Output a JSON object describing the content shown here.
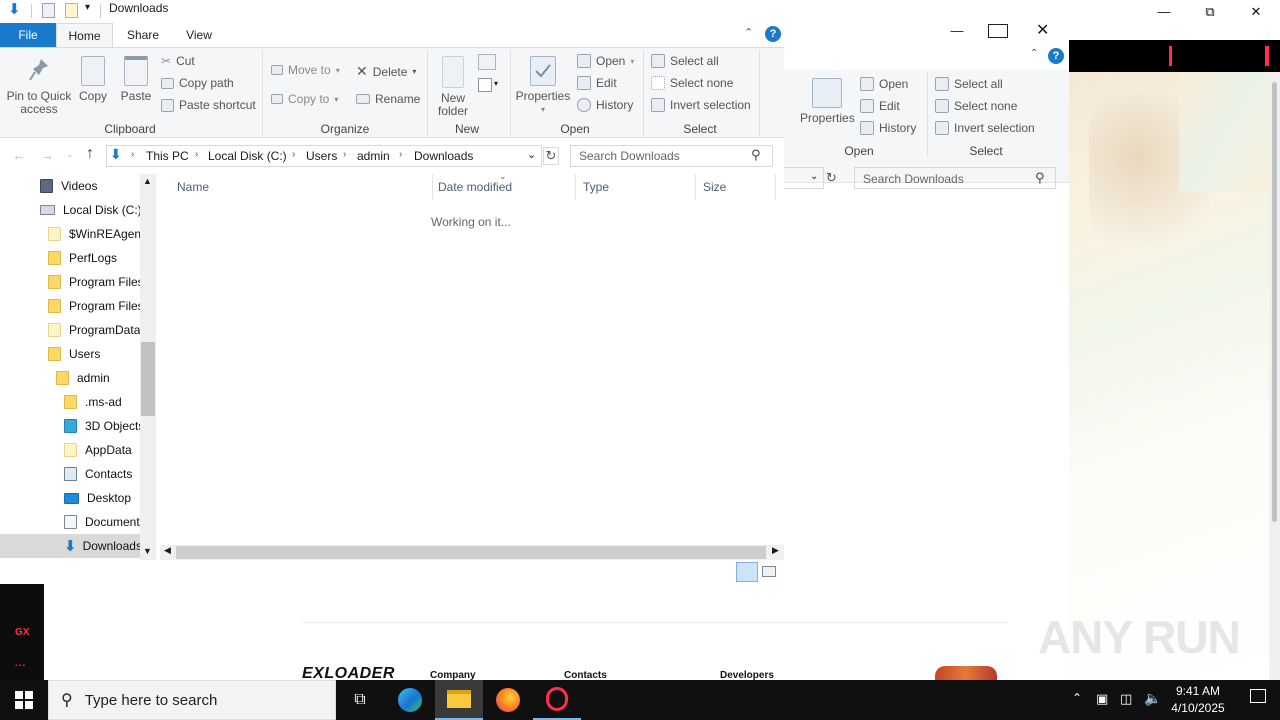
{
  "explorer": {
    "title": "Downloads",
    "tabs": {
      "file": "File",
      "home": "Home",
      "share": "Share",
      "view": "View"
    },
    "ribbon": {
      "pin_label": "Pin to Quick access",
      "copy_label": "Copy",
      "paste_label": "Paste",
      "cut_label": "Cut",
      "copy_path_label": "Copy path",
      "paste_shortcut_label": "Paste shortcut",
      "clipboard_group": "Clipboard",
      "move_to_label": "Move to",
      "copy_to_label": "Copy to",
      "delete_label": "Delete",
      "rename_label": "Rename",
      "organize_group": "Organize",
      "new_folder_label": "New folder",
      "new_group": "New",
      "properties_label": "Properties",
      "open_label": "Open",
      "edit_label": "Edit",
      "history_label": "History",
      "open_group": "Open",
      "select_all_label": "Select all",
      "select_none_label": "Select none",
      "invert_selection_label": "Invert selection",
      "select_group": "Select"
    },
    "address": {
      "crumbs": [
        "This PC",
        "Local Disk (C:)",
        "Users",
        "admin",
        "Downloads"
      ],
      "search_placeholder": "Search Downloads"
    },
    "nav": {
      "items": [
        {
          "label": "Videos"
        },
        {
          "label": "Local Disk (C:)"
        },
        {
          "label": "$WinREAgent"
        },
        {
          "label": "PerfLogs"
        },
        {
          "label": "Program Files"
        },
        {
          "label": "Program Files"
        },
        {
          "label": "ProgramData"
        },
        {
          "label": "Users"
        },
        {
          "label": "admin"
        },
        {
          "label": ".ms-ad"
        },
        {
          "label": "3D Objects"
        },
        {
          "label": "AppData"
        },
        {
          "label": "Contacts"
        },
        {
          "label": "Desktop"
        },
        {
          "label": "Documents"
        },
        {
          "label": "Downloads"
        }
      ]
    },
    "columns": [
      "Name",
      "Date modified",
      "Type",
      "Size"
    ],
    "status_text": "Working on it..."
  },
  "explorer2": {
    "properties_label": "Properties",
    "open_label": "Open",
    "edit_label": "Edit",
    "history_label": "History",
    "open_group": "Open",
    "select_all_label": "Select all",
    "select_none_label": "Select none",
    "invert_selection_label": "Invert selection",
    "select_group": "Select",
    "search_placeholder": "Search Downloads"
  },
  "browser_page": {
    "logo": "EXLOADER",
    "footer": [
      "Company",
      "Contacts",
      "Developers"
    ],
    "sidebar_badge": "GX",
    "sidebar_more": "...",
    "watermark": "ANY RUN"
  },
  "taskbar": {
    "search_placeholder": "Type here to search",
    "time": "9:41 AM",
    "date": "4/10/2025"
  },
  "colors": {
    "accent": "#1979ca",
    "gx_red": "#ff2e4d",
    "taskbar": "#101010"
  }
}
